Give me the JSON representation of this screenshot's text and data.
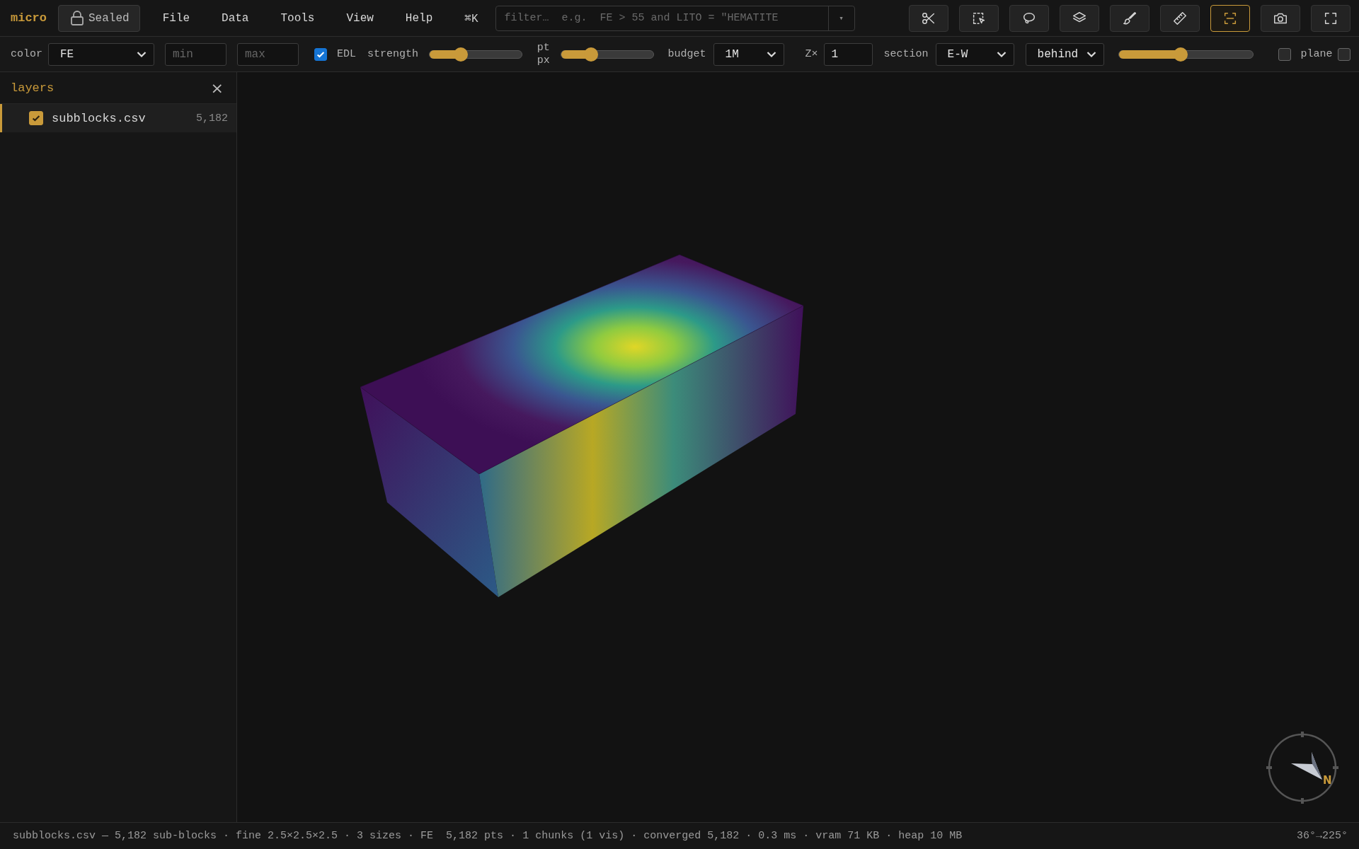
{
  "app": {
    "logo": "micro",
    "lock_button": {
      "label": "Sealed"
    }
  },
  "menu": [
    {
      "label": "File"
    },
    {
      "label": "Data"
    },
    {
      "label": "Tools"
    },
    {
      "label": "View"
    },
    {
      "label": "Help"
    }
  ],
  "shortcut": "⌘K",
  "filter": {
    "placeholder": "filter…  e.g.  FE > 55 and LITO = \"HEMATITE",
    "dropdown": "▾"
  },
  "tools": [
    {
      "kind": "scissors",
      "selected": false
    },
    {
      "kind": "box-select",
      "selected": false
    },
    {
      "kind": "lasso",
      "selected": false
    },
    {
      "kind": "layers",
      "selected": false
    },
    {
      "kind": "brush",
      "selected": false
    },
    {
      "kind": "ruler",
      "selected": false
    },
    {
      "kind": "scan",
      "selected": true
    },
    {
      "kind": "camera",
      "selected": false
    },
    {
      "kind": "fullscreen",
      "selected": false
    }
  ],
  "toolbar": {
    "color": {
      "label": "color",
      "value": "FE"
    },
    "min": {
      "placeholder": "min"
    },
    "max": {
      "placeholder": "max"
    },
    "edl": {
      "label": "EDL",
      "checked": true
    },
    "strength": {
      "label": "strength",
      "level": 0.34
    },
    "point_size": {
      "label": "pt px",
      "level": 0.33
    },
    "budget": {
      "label": "budget",
      "value": "1M"
    },
    "z_scale": {
      "label": "Z×",
      "value": "1"
    },
    "section": {
      "label": "section",
      "value": "E-W"
    },
    "section_mode": {
      "value": "behind"
    },
    "section_position": {
      "level": 0.46
    },
    "section_toggle": {
      "checked": false
    },
    "plane": {
      "label": "plane",
      "checked": false
    }
  },
  "layers": {
    "title": "layers",
    "close": "×",
    "items": [
      {
        "name": "subblocks.csv",
        "count": "5,182",
        "checked": true,
        "selected": true
      }
    ]
  },
  "compass": {
    "label": "N"
  },
  "status_bar": {
    "left": "subblocks.csv — 5,182 sub-blocks · fine 2.5×2.5×2.5 · 3 sizes · FE",
    "middle": "5,182 pts · 1 chunks (1 vis) · converged 5,182 · 0.3 ms · vram 71 KB · heap 10 MB",
    "right": "36°→225°"
  }
}
